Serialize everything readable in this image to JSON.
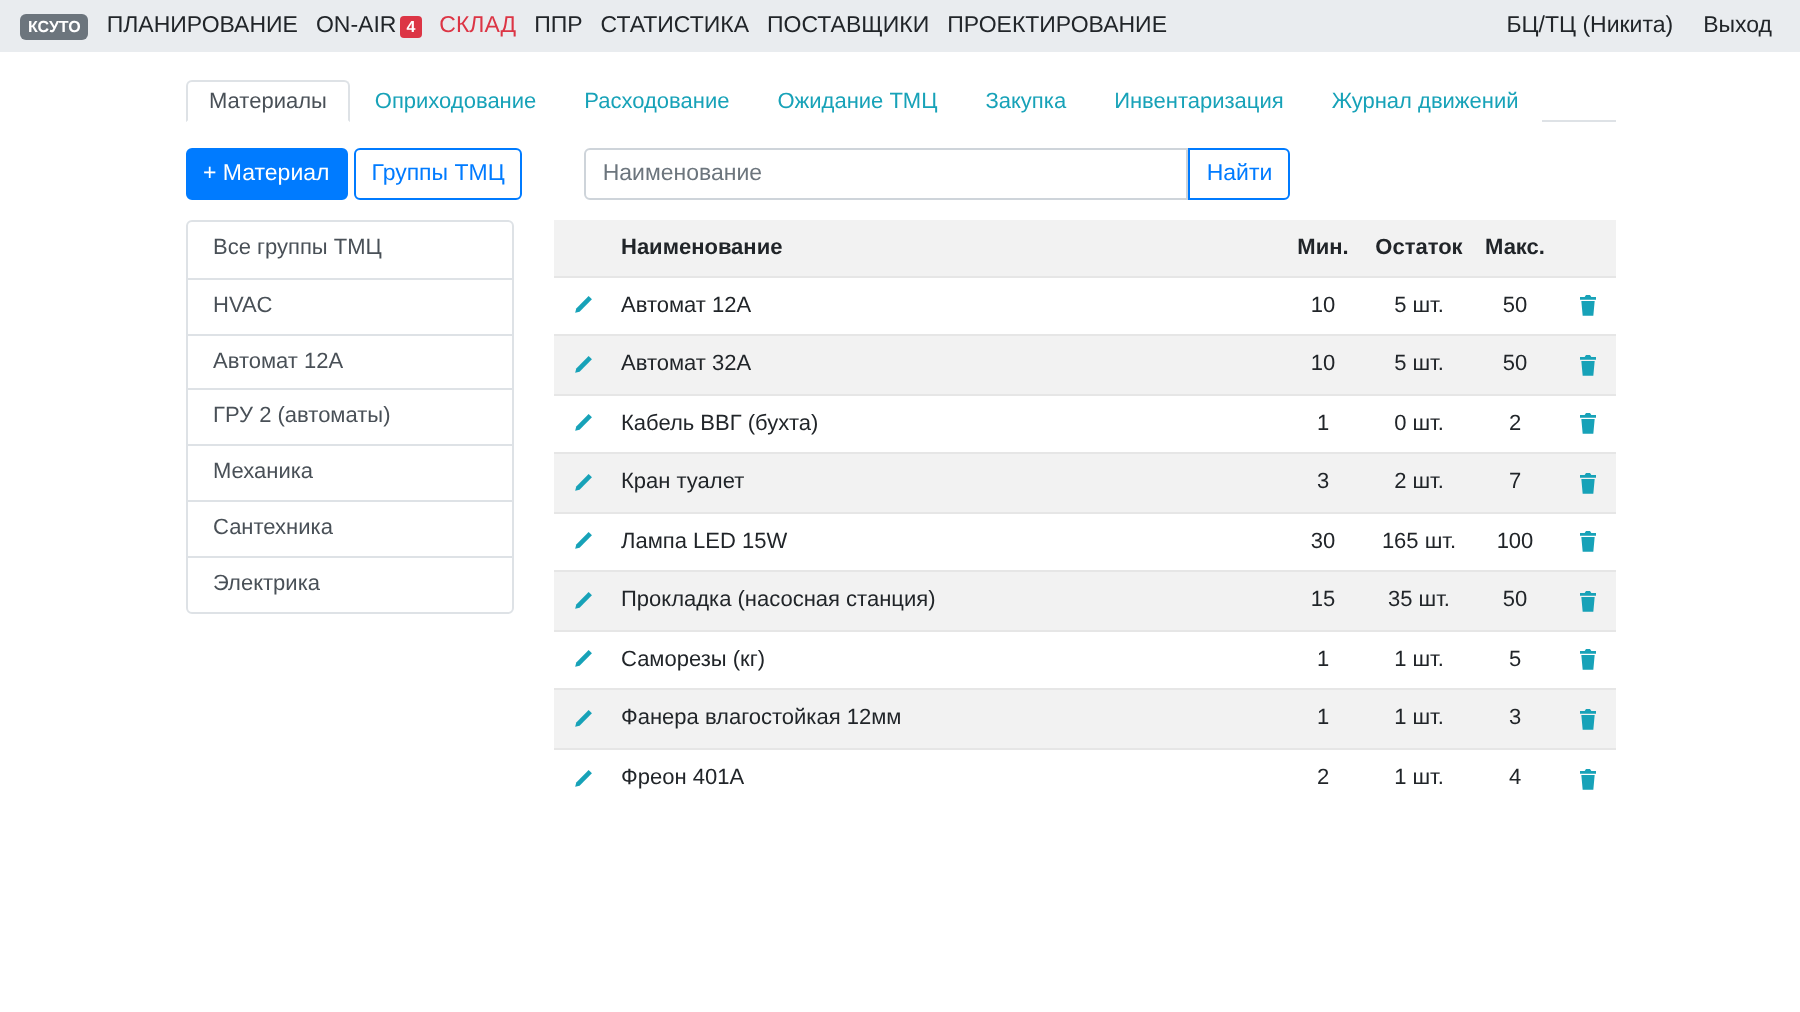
{
  "navbar": {
    "brand": "КСУТО",
    "items": [
      {
        "label": "ПЛАНИРОВАНИЕ",
        "selected": false
      },
      {
        "label": "ON-AIR",
        "selected": false,
        "badge": "4"
      },
      {
        "label": "СКЛАД",
        "selected": true
      },
      {
        "label": "ППР",
        "selected": false
      },
      {
        "label": "СТАТИСТИКА",
        "selected": false
      },
      {
        "label": "ПОСТАВЩИКИ",
        "selected": false
      },
      {
        "label": "ПРОЕКТИРОВАНИЕ",
        "selected": false
      }
    ],
    "user": "БЦ/ТЦ (Никита)",
    "logout": "Выход"
  },
  "tabs": [
    {
      "label": "Материалы",
      "selected": true
    },
    {
      "label": "Оприходование",
      "selected": false
    },
    {
      "label": "Расходование",
      "selected": false
    },
    {
      "label": "Ожидание ТМЦ",
      "selected": false
    },
    {
      "label": "Закупка",
      "selected": false
    },
    {
      "label": "Инвентаризация",
      "selected": false
    },
    {
      "label": "Журнал движений",
      "selected": false
    }
  ],
  "toolbar": {
    "add_button": "+ Материал",
    "groups_button": "Группы ТМЦ",
    "search": {
      "placeholder": "Наименование"
    },
    "search_button": "Найти"
  },
  "groups": [
    "Все группы ТМЦ",
    "HVAC",
    "Автомат 12А",
    "ГРУ 2 (автоматы)",
    "Механика",
    "Сантехника",
    "Электрика"
  ],
  "table": {
    "columns": [
      "Наименование",
      "Мин.",
      "Остаток",
      "Макс."
    ],
    "rows": [
      {
        "name": "Автомат 12А",
        "min": "10",
        "stock": "5 шт.",
        "max": "50"
      },
      {
        "name": "Автомат 32А",
        "min": "10",
        "stock": "5 шт.",
        "max": "50"
      },
      {
        "name": "Кабель ВВГ (бухта)",
        "min": "1",
        "stock": "0 шт.",
        "max": "2"
      },
      {
        "name": "Кран туалет",
        "min": "3",
        "stock": "2 шт.",
        "max": "7"
      },
      {
        "name": "Лампа LED 15W",
        "min": "30",
        "stock": "165 шт.",
        "max": "100"
      },
      {
        "name": "Прокладка (насосная станция)",
        "min": "15",
        "stock": "35 шт.",
        "max": "50"
      },
      {
        "name": "Саморезы (кг)",
        "min": "1",
        "stock": "1 шт.",
        "max": "5"
      },
      {
        "name": "Фанера влагостойкая 12мм",
        "min": "1",
        "stock": "1 шт.",
        "max": "3"
      },
      {
        "name": "Фреон 401А",
        "min": "2",
        "stock": "1 шт.",
        "max": "4"
      }
    ]
  }
}
